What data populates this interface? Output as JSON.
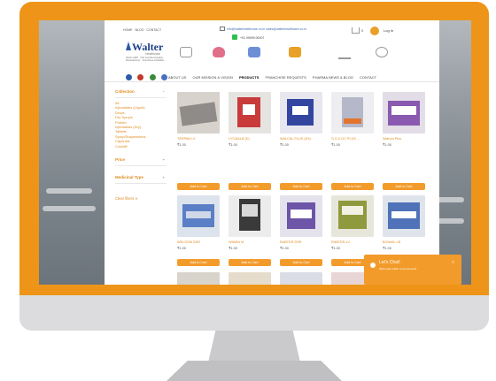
{
  "header": {
    "top_links": "HOME · BLOG · CONTACT",
    "email": "info@walterhealthcare.co.in  sales@walterhealthcare.co.in",
    "phone": "+91 99999 00007",
    "cart_count": "0",
    "login": "Log In"
  },
  "brand": {
    "name": "Walter",
    "sub": "Healthcare",
    "tagline": "WHO GMP · ISO Certified Quality Manufacturer · Franchise Available"
  },
  "nav": {
    "items": [
      {
        "label": "ABOUT US"
      },
      {
        "label": "OUR MISSION & VISION"
      },
      {
        "label": "PRODUCTS"
      },
      {
        "label": "FRANCHISE REQUESTS"
      },
      {
        "label": "PHARMA NEWS & BLOG"
      },
      {
        "label": "CONTACT"
      }
    ]
  },
  "sidebar": {
    "collection_title": "Collection",
    "items": [
      {
        "label": "All"
      },
      {
        "label": "Injectables (Liquid)"
      },
      {
        "label": "Drops"
      },
      {
        "label": "Dry Syrups"
      },
      {
        "label": "Protein"
      },
      {
        "label": "Injectables (Dry)"
      },
      {
        "label": "Tablets"
      },
      {
        "label": "Syrup/Suspensions"
      },
      {
        "label": "Capsules"
      },
      {
        "label": "Cooldift"
      }
    ],
    "price_title": "Price",
    "medicinal_title": "Medicinal Type",
    "clear": "Clear filters ✕"
  },
  "products": [
    {
      "title": "TERPAN LV",
      "price": "₹1.00",
      "button": "Add to Cart"
    },
    {
      "title": "LYCMALB (D)",
      "price": "₹1.00",
      "button": "Add to Cart"
    },
    {
      "title": "WALCAL PLUS (D3)",
      "price": "₹1.00",
      "button": "Add to Cart"
    },
    {
      "title": "G.S.X.OC PLUS ...",
      "price": "₹1.00",
      "button": "Add to Cart"
    },
    {
      "title": "Walnon Plus",
      "price": "₹1.00",
      "button": "Add to Cart"
    },
    {
      "title": "WELSOM DSR",
      "price": "₹1.00",
      "button": "Add to Cart"
    },
    {
      "title": "WAMIN M",
      "price": "₹1.00",
      "button": "Add to Cart"
    },
    {
      "title": "RABTER DSR",
      "price": "₹1.00",
      "button": "Add to Cart"
    },
    {
      "title": "RABTER-LV",
      "price": "₹1.00",
      "button": "Add to Cart"
    },
    {
      "title": "BIOWAL LB",
      "price": "₹1.00",
      "button": "Add to Cart"
    }
  ],
  "chat": {
    "title": "Let's Chat!",
    "subtitle": "We'll reply within a few seconds"
  },
  "colors": {
    "accent": "#f29b2b",
    "bezel": "#ee9519",
    "brand_blue": "#1d3f8a"
  }
}
